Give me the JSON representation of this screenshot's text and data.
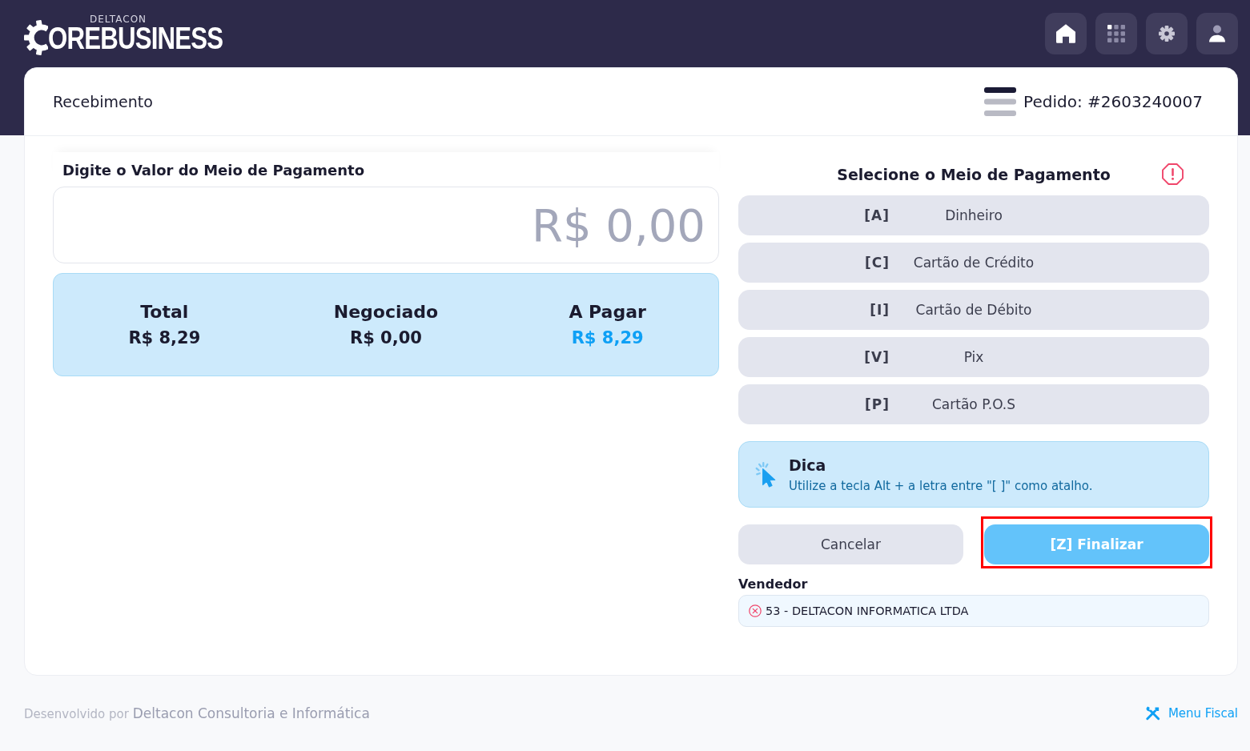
{
  "logo": {
    "tagline": "DELTACON",
    "wordmark": "OREBUSINESS"
  },
  "page": {
    "title": "Recebimento",
    "order": "Pedido: #2603240007"
  },
  "amount_entry": {
    "title": "Digite o Valor do Meio de Pagamento",
    "placeholder": "R$ 0,00"
  },
  "summary": [
    {
      "label": "Total",
      "value": "R$ 8,29",
      "color": "#1b1b2f"
    },
    {
      "label": "Negociado",
      "value": "R$ 0,00",
      "color": "#1b1b2f"
    },
    {
      "label": "A Pagar",
      "value": "R$ 8,29",
      "color": "#0ea0f5"
    }
  ],
  "payment_methods": {
    "title": "Selecione o Meio de Pagamento",
    "options": [
      {
        "key": "[A]",
        "label": "Dinheiro"
      },
      {
        "key": "[C]",
        "label": "Cartão de Crédito"
      },
      {
        "key": "[I]",
        "label": "Cartão de Débito"
      },
      {
        "key": "[V]",
        "label": "Pix"
      },
      {
        "key": "[P]",
        "label": "Cartão P.O.S"
      }
    ]
  },
  "tip": {
    "title": "Dica",
    "text": "Utilize a tecla Alt + a letra entre \"[ ]\" como atalho."
  },
  "actions": [
    {
      "label": "Cancelar",
      "kind": "secondary",
      "highlighted": false
    },
    {
      "label": "[Z] Finalizar",
      "kind": "primary",
      "highlighted": true
    }
  ],
  "seller": {
    "label": "Vendedor",
    "value": "53 - DELTACON INFORMATICA LTDA"
  },
  "footer": {
    "credit": "Desenvolvido por **Deltacon Consultoria e Informática**",
    "link": "Menu Fiscal"
  }
}
